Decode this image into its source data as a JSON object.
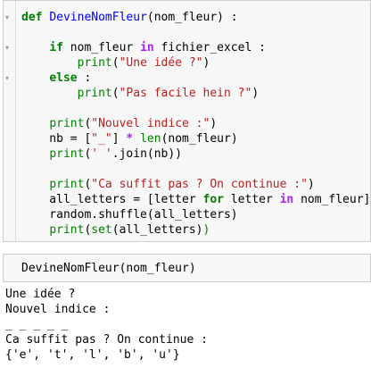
{
  "cell1": {
    "lines": [
      [
        [
          "kw",
          "def "
        ],
        [
          "fn",
          "DevineNomFleur"
        ],
        [
          "t",
          "(nom_fleur) :"
        ]
      ],
      [
        [
          "t",
          ""
        ]
      ],
      [
        [
          "t",
          "    "
        ],
        [
          "kw",
          "if"
        ],
        [
          "t",
          " nom_fleur "
        ],
        [
          "op",
          "in"
        ],
        [
          "t",
          " fichier_excel :"
        ]
      ],
      [
        [
          "t",
          "        "
        ],
        [
          "bi",
          "print"
        ],
        [
          "t",
          "("
        ],
        [
          "st",
          "\"Une idée ?\""
        ],
        [
          "t",
          ")"
        ]
      ],
      [
        [
          "t",
          "    "
        ],
        [
          "kw",
          "else"
        ],
        [
          "t",
          " :"
        ]
      ],
      [
        [
          "t",
          "        "
        ],
        [
          "bi",
          "print"
        ],
        [
          "t",
          "("
        ],
        [
          "st",
          "\"Pas facile hein ?\""
        ],
        [
          "t",
          ")"
        ]
      ],
      [
        [
          "t",
          ""
        ]
      ],
      [
        [
          "t",
          "    "
        ],
        [
          "bi",
          "print"
        ],
        [
          "t",
          "("
        ],
        [
          "st",
          "\"Nouvel indice :\""
        ],
        [
          "t",
          ")"
        ]
      ],
      [
        [
          "t",
          "    nb = ["
        ],
        [
          "st",
          "\"_\""
        ],
        [
          "t",
          "] "
        ],
        [
          "op",
          "*"
        ],
        [
          "t",
          " "
        ],
        [
          "bi",
          "len"
        ],
        [
          "t",
          "(nom_fleur)"
        ]
      ],
      [
        [
          "t",
          "    "
        ],
        [
          "bi",
          "print"
        ],
        [
          "t",
          "("
        ],
        [
          "st",
          "' '"
        ],
        [
          "t",
          ".join(nb))"
        ]
      ],
      [
        [
          "t",
          ""
        ]
      ],
      [
        [
          "t",
          "    "
        ],
        [
          "bi",
          "print"
        ],
        [
          "t",
          "("
        ],
        [
          "st",
          "\"Ca suffit pas ? On continue :\""
        ],
        [
          "t",
          ")"
        ]
      ],
      [
        [
          "t",
          "    all_letters = [letter "
        ],
        [
          "kw",
          "for"
        ],
        [
          "t",
          " letter "
        ],
        [
          "op",
          "in"
        ],
        [
          "t",
          " nom_fleur]"
        ]
      ],
      [
        [
          "t",
          "    random.shuffle(all_letters)"
        ]
      ],
      [
        [
          "t",
          "    "
        ],
        [
          "bi",
          "print"
        ],
        [
          "t",
          "("
        ],
        [
          "bi",
          "set"
        ],
        [
          "t",
          "(all_letters)"
        ],
        [
          "bi",
          ")"
        ]
      ]
    ]
  },
  "cell2": {
    "code": "DevineNomFleur(nom_fleur)"
  },
  "output": {
    "lines": [
      "Une idée ?",
      "Nouvel indice :",
      "_ _ _ _ _",
      "Ca suffit pas ? On continue :",
      "{'e', 't', 'l', 'b', 'u'}"
    ]
  },
  "icons": {
    "fold": "fold-arrow-icon"
  }
}
